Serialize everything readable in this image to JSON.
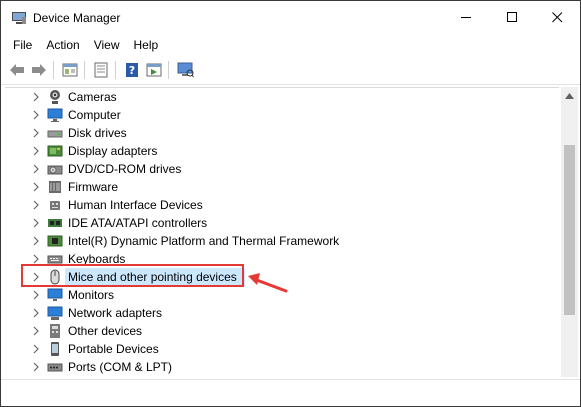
{
  "window": {
    "title": "Device Manager"
  },
  "menu": [
    "File",
    "Action",
    "View",
    "Help"
  ],
  "toolbar": [
    "back-icon",
    "forward-icon",
    "properties-icon",
    "show-hidden-icon",
    "help-icon",
    "run-icon",
    "scan-hardware-icon"
  ],
  "tree": {
    "items": [
      {
        "label": "Cameras",
        "icon": "camera-icon"
      },
      {
        "label": "Computer",
        "icon": "computer-icon"
      },
      {
        "label": "Disk drives",
        "icon": "disk-drive-icon"
      },
      {
        "label": "Display adapters",
        "icon": "display-adapter-icon"
      },
      {
        "label": "DVD/CD-ROM drives",
        "icon": "dvd-drive-icon"
      },
      {
        "label": "Firmware",
        "icon": "firmware-icon"
      },
      {
        "label": "Human Interface Devices",
        "icon": "hid-icon"
      },
      {
        "label": "IDE ATA/ATAPI controllers",
        "icon": "ide-controller-icon"
      },
      {
        "label": "Intel(R) Dynamic Platform and Thermal Framework",
        "icon": "chip-icon"
      },
      {
        "label": "Keyboards",
        "icon": "keyboard-icon"
      },
      {
        "label": "Mice and other pointing devices",
        "icon": "mouse-icon",
        "selected": true
      },
      {
        "label": "Monitors",
        "icon": "monitor-icon"
      },
      {
        "label": "Network adapters",
        "icon": "network-adapter-icon"
      },
      {
        "label": "Other devices",
        "icon": "other-devices-icon"
      },
      {
        "label": "Portable Devices",
        "icon": "portable-device-icon"
      },
      {
        "label": "Ports (COM & LPT)",
        "icon": "port-icon"
      }
    ]
  },
  "colors": {
    "selection": "#cce8ff",
    "annotation": "#e53935"
  }
}
